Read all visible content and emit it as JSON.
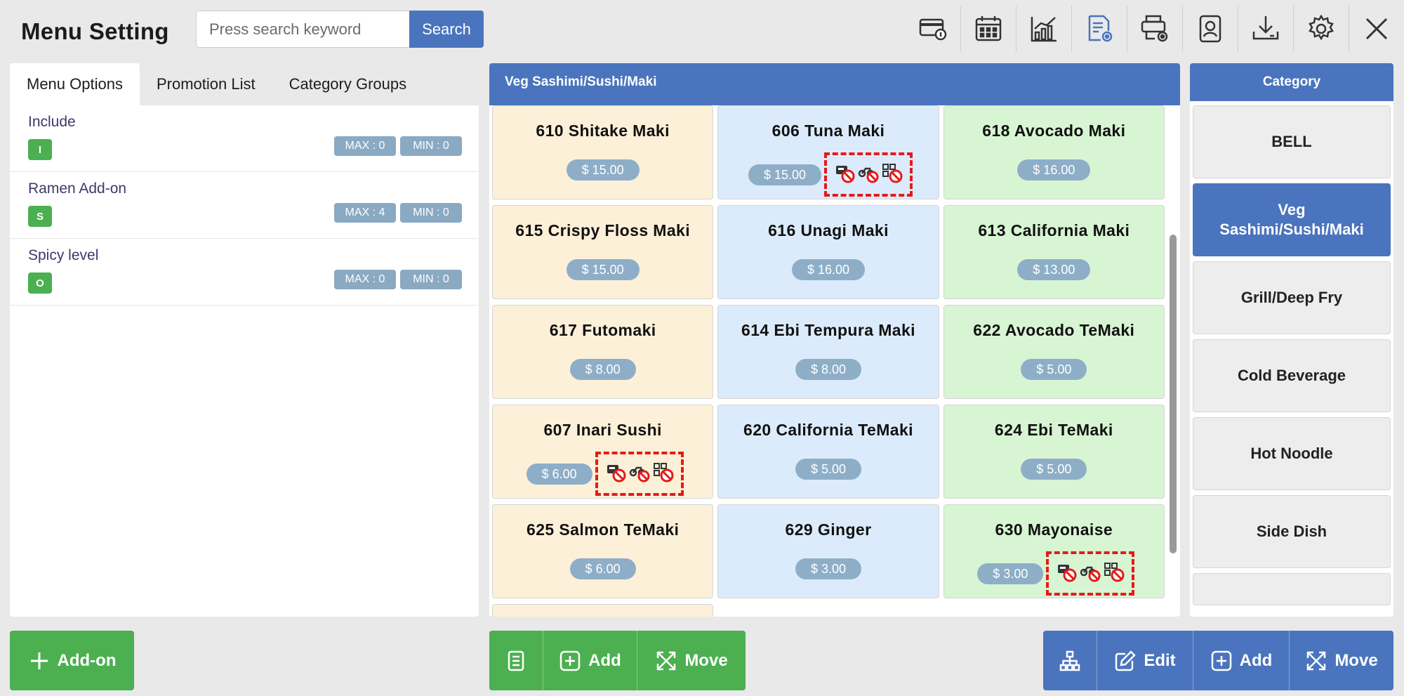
{
  "header": {
    "title": "Menu Setting",
    "search_placeholder": "Press search keyword",
    "search_label": "Search",
    "tools": [
      "card-info-icon",
      "calendar-icon",
      "chart-icon",
      "report-settings-icon",
      "printer-settings-icon",
      "user-badge-icon",
      "download-icon",
      "gear-icon",
      "close-icon"
    ]
  },
  "left": {
    "tabs": [
      "Menu Options",
      "Promotion List",
      "Category Groups"
    ],
    "active_tab": 0,
    "options": [
      {
        "name": "Include",
        "badge": "I",
        "max": "MAX : 0",
        "min": "MIN : 0"
      },
      {
        "name": "Ramen Add-on",
        "badge": "S",
        "max": "MAX : 4",
        "min": "MIN : 0"
      },
      {
        "name": "Spicy level",
        "badge": "O",
        "max": "MAX : 0",
        "min": "MIN : 0"
      }
    ],
    "add_on_label": "Add-on"
  },
  "mid": {
    "header": "Veg Sashimi/Sushi/Maki",
    "items": [
      {
        "name": "610 Shitake Maki",
        "price": "$ 15.00",
        "flags": false
      },
      {
        "name": "606 Tuna Maki",
        "price": "$ 15.00",
        "flags": true
      },
      {
        "name": "618 Avocado Maki",
        "price": "$ 16.00",
        "flags": false
      },
      {
        "name": "615 Crispy Floss Maki",
        "price": "$ 15.00",
        "flags": false
      },
      {
        "name": "616 Unagi Maki",
        "price": "$ 16.00",
        "flags": false
      },
      {
        "name": "613 California Maki",
        "price": "$ 13.00",
        "flags": false
      },
      {
        "name": "617 Futomaki",
        "price": "$ 8.00",
        "flags": false
      },
      {
        "name": "614 Ebi Tempura Maki",
        "price": "$ 8.00",
        "flags": false
      },
      {
        "name": "622 Avocado TeMaki",
        "price": "$ 5.00",
        "flags": false
      },
      {
        "name": "607 Inari Sushi",
        "price": "$ 6.00",
        "flags": true
      },
      {
        "name": "620 California TeMaki",
        "price": "$ 5.00",
        "flags": false
      },
      {
        "name": "624 Ebi TeMaki",
        "price": "$ 5.00",
        "flags": false
      },
      {
        "name": "625 Salmon TeMaki",
        "price": "$ 6.00",
        "flags": false
      },
      {
        "name": "629 Ginger",
        "price": "$ 3.00",
        "flags": false
      },
      {
        "name": "630 Mayonaise",
        "price": "$ 3.00",
        "flags": true
      }
    ],
    "buttons": {
      "add": "Add",
      "move": "Move"
    }
  },
  "right": {
    "header": "Category",
    "categories": [
      "BELL",
      "Veg Sashimi/Sushi/Maki",
      "Grill/Deep Fry",
      "Cold Beverage",
      "Hot Noodle",
      "Side Dish"
    ],
    "active_index": 1,
    "buttons": {
      "edit": "Edit",
      "add": "Add",
      "move": "Move"
    }
  },
  "colors": {
    "accent": "#4a74bd",
    "green": "#4caf50",
    "card_orange": "#fdf0d8",
    "card_blue": "#dcebfb",
    "card_green": "#d8f5d3",
    "flag_red": "#e31b1b"
  }
}
